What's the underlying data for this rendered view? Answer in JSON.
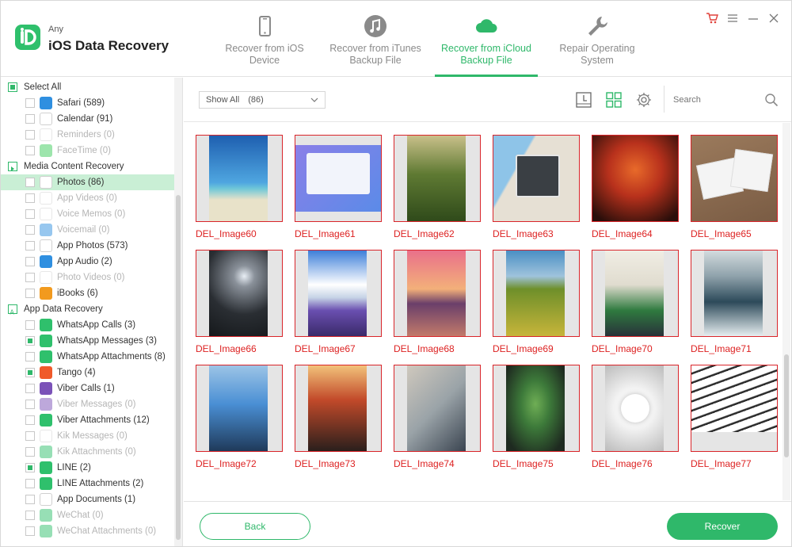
{
  "app": {
    "brand_small": "Any",
    "brand_big": "iOS Data Recovery",
    "accent": "#2fb86a"
  },
  "tabs": [
    {
      "label_line1": "Recover from iOS",
      "label_line2": "Device",
      "icon": "phone-icon",
      "active": false
    },
    {
      "label_line1": "Recover from iTunes",
      "label_line2": "Backup File",
      "icon": "music-note-icon",
      "active": false
    },
    {
      "label_line1": "Recover from iCloud",
      "label_line2": "Backup File",
      "icon": "cloud-icon",
      "active": true
    },
    {
      "label_line1": "Repair Operating",
      "label_line2": "System",
      "icon": "wrench-icon",
      "active": false
    }
  ],
  "window_controls": [
    "cart-icon",
    "menu-icon",
    "minimize-icon",
    "close-icon"
  ],
  "sidebar": {
    "rows": [
      {
        "label": "Select All",
        "type": "header",
        "icon": ""
      },
      {
        "label": "Safari (589)",
        "type": "item",
        "icon": "safari-icon"
      },
      {
        "label": "Calendar (91)",
        "type": "item",
        "icon": "calendar-icon"
      },
      {
        "label": "Reminders (0)",
        "type": "item",
        "icon": "reminders-icon",
        "dim": true
      },
      {
        "label": "FaceTime (0)",
        "type": "item",
        "icon": "facetime-icon",
        "dim": true
      },
      {
        "label": "Media Content Recovery",
        "type": "category",
        "icon": ""
      },
      {
        "label": "Photos (86)",
        "type": "item",
        "icon": "photos-icon",
        "selected": true
      },
      {
        "label": "App Videos (0)",
        "type": "item",
        "icon": "app-videos-icon",
        "dim": true
      },
      {
        "label": "Voice Memos (0)",
        "type": "item",
        "icon": "voice-memos-icon",
        "dim": true
      },
      {
        "label": "Voicemail (0)",
        "type": "item",
        "icon": "voicemail-icon",
        "dim": true
      },
      {
        "label": "App Photos (573)",
        "type": "item",
        "icon": "app-photos-icon"
      },
      {
        "label": "App Audio (2)",
        "type": "item",
        "icon": "app-audio-icon"
      },
      {
        "label": "Photo Videos (0)",
        "type": "item",
        "icon": "photo-videos-icon",
        "dim": true
      },
      {
        "label": "iBooks (6)",
        "type": "item",
        "icon": "ibooks-icon"
      },
      {
        "label": "App Data Recovery",
        "type": "category2",
        "icon": ""
      },
      {
        "label": "WhatsApp Calls (3)",
        "type": "item",
        "icon": "whatsapp-icon"
      },
      {
        "label": "WhatsApp Messages (3)",
        "type": "item",
        "icon": "whatsapp-icon",
        "partial": true
      },
      {
        "label": "WhatsApp Attachments (8)",
        "type": "item",
        "icon": "attachment-icon"
      },
      {
        "label": "Tango (4)",
        "type": "item",
        "icon": "tango-icon",
        "partial": true
      },
      {
        "label": "Viber Calls (1)",
        "type": "item",
        "icon": "viber-icon"
      },
      {
        "label": "Viber Messages (0)",
        "type": "item",
        "icon": "viber-icon",
        "dim": true
      },
      {
        "label": "Viber Attachments (12)",
        "type": "item",
        "icon": "attachment-icon"
      },
      {
        "label": "Kik Messages (0)",
        "type": "item",
        "icon": "kik-icon",
        "dim": true
      },
      {
        "label": "Kik Attachments (0)",
        "type": "item",
        "icon": "attachment-icon",
        "dim": true
      },
      {
        "label": "LINE (2)",
        "type": "item",
        "icon": "line-icon",
        "partial": true
      },
      {
        "label": "LINE Attachments (2)",
        "type": "item",
        "icon": "attachment-icon"
      },
      {
        "label": "App Documents (1)",
        "type": "item",
        "icon": "document-icon"
      },
      {
        "label": "WeChat (0)",
        "type": "item",
        "icon": "wechat-icon",
        "dim": true
      },
      {
        "label": "WeChat Attachments (0)",
        "type": "item",
        "icon": "attachment-icon",
        "dim": true
      }
    ]
  },
  "toolbar": {
    "filter_label": "Show All",
    "filter_count": "(86)",
    "search_placeholder": "Search",
    "buttons": [
      "timeline-view-icon",
      "grid-view-icon",
      "settings-icon"
    ]
  },
  "gallery": {
    "images": [
      {
        "name": "DEL_Image60",
        "kind": "beach",
        "colors": [
          "#1e5fb0",
          "#4fa6e0",
          "#e8e2c9"
        ]
      },
      {
        "name": "DEL_Image61",
        "kind": "screen",
        "colors": [
          "#8a7fe8",
          "#5b8be8",
          "#f2f4fb"
        ]
      },
      {
        "name": "DEL_Image62",
        "kind": "hills",
        "colors": [
          "#c9c08a",
          "#5f7a33",
          "#2f4a1a"
        ]
      },
      {
        "name": "DEL_Image63",
        "kind": "map",
        "colors": [
          "#e6e0d4",
          "#8ec4e8",
          "#444444"
        ]
      },
      {
        "name": "DEL_Image64",
        "kind": "street",
        "colors": [
          "#2a0e0a",
          "#b8311c",
          "#e86a2a"
        ]
      },
      {
        "name": "DEL_Image65",
        "kind": "photos",
        "colors": [
          "#9b7a5c",
          "#f4f4f4",
          "#1f1f1f"
        ]
      },
      {
        "name": "DEL_Image66",
        "kind": "tree",
        "colors": [
          "#2a2e33",
          "#8a919a",
          "#15181b"
        ]
      },
      {
        "name": "DEL_Image67",
        "kind": "lavender",
        "colors": [
          "#3d7fd9",
          "#ffffff",
          "#6a4fb0"
        ]
      },
      {
        "name": "DEL_Image68",
        "kind": "sunset",
        "colors": [
          "#e9708a",
          "#f3b07a",
          "#6a3f6a"
        ]
      },
      {
        "name": "DEL_Image69",
        "kind": "field",
        "colors": [
          "#4a8fc4",
          "#6e8f2a",
          "#c7b53a"
        ]
      },
      {
        "name": "DEL_Image70",
        "kind": "plant",
        "colors": [
          "#f0ede4",
          "#2f7a3f",
          "#28323a"
        ]
      },
      {
        "name": "DEL_Image71",
        "kind": "sea",
        "colors": [
          "#8fa2ab",
          "#2d4a5a",
          "#e6eef0"
        ]
      },
      {
        "name": "DEL_Image72",
        "kind": "pier",
        "colors": [
          "#4a8fd4",
          "#9cc4e6",
          "#1f3a5a"
        ]
      },
      {
        "name": "DEL_Image73",
        "kind": "alley",
        "colors": [
          "#2a1f1c",
          "#c24a2a",
          "#f2c27a"
        ]
      },
      {
        "name": "DEL_Image74",
        "kind": "aerial",
        "colors": [
          "#cfc8bd",
          "#9aa3a8",
          "#3a4450"
        ]
      },
      {
        "name": "DEL_Image75",
        "kind": "fern",
        "colors": [
          "#1e2a20",
          "#3d7a3a",
          "#6fae55"
        ]
      },
      {
        "name": "DEL_Image76",
        "kind": "flower",
        "colors": [
          "#f6f6f6",
          "#ffffff",
          "#bbbbbb"
        ]
      },
      {
        "name": "DEL_Image77",
        "kind": "spiral",
        "colors": [
          "#ffffff",
          "#2c2c2c",
          "#c2dfe6"
        ]
      }
    ]
  },
  "footer": {
    "back_label": "Back",
    "recover_label": "Recover"
  }
}
